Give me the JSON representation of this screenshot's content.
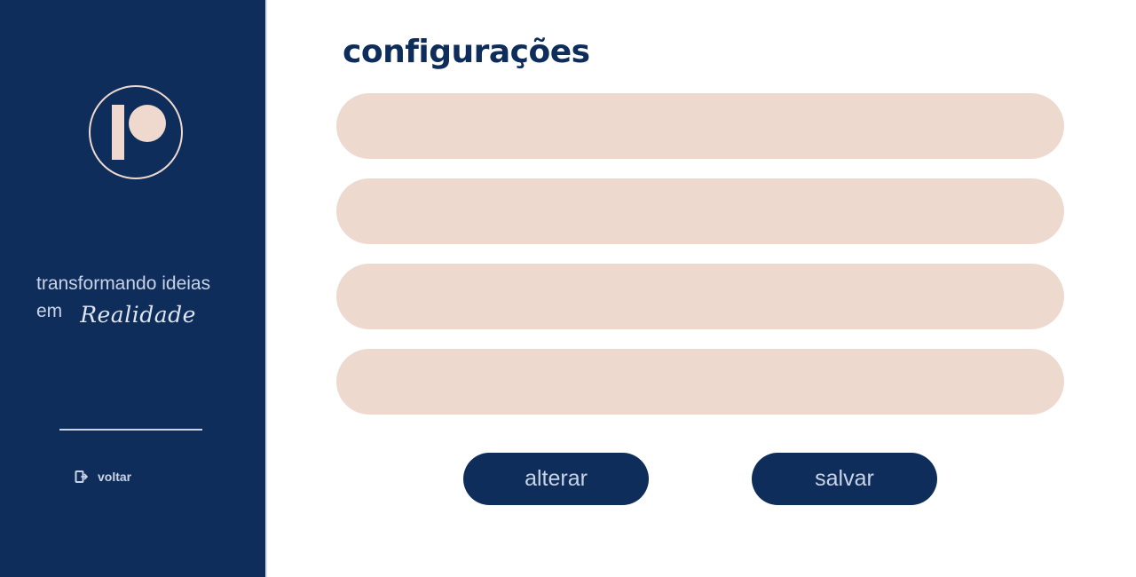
{
  "sidebar": {
    "logo_icon": "brand-p-logo-icon",
    "tagline_line1": "transformando ideias",
    "tagline_em": "em",
    "tagline_script": "Realidade",
    "back_label": "voltar",
    "back_icon": "exit-icon"
  },
  "main": {
    "title": "configurações",
    "fields": [
      {
        "value": "",
        "placeholder": ""
      },
      {
        "value": "",
        "placeholder": ""
      },
      {
        "value": "",
        "placeholder": ""
      },
      {
        "value": "",
        "placeholder": ""
      }
    ],
    "alter_label": "alterar",
    "save_label": "salvar"
  },
  "colors": {
    "primary": "#0f2d5a",
    "field_background": "#eed9cf",
    "accent_light": "#efd9cf",
    "sidebar_text": "#c9d3e6"
  }
}
